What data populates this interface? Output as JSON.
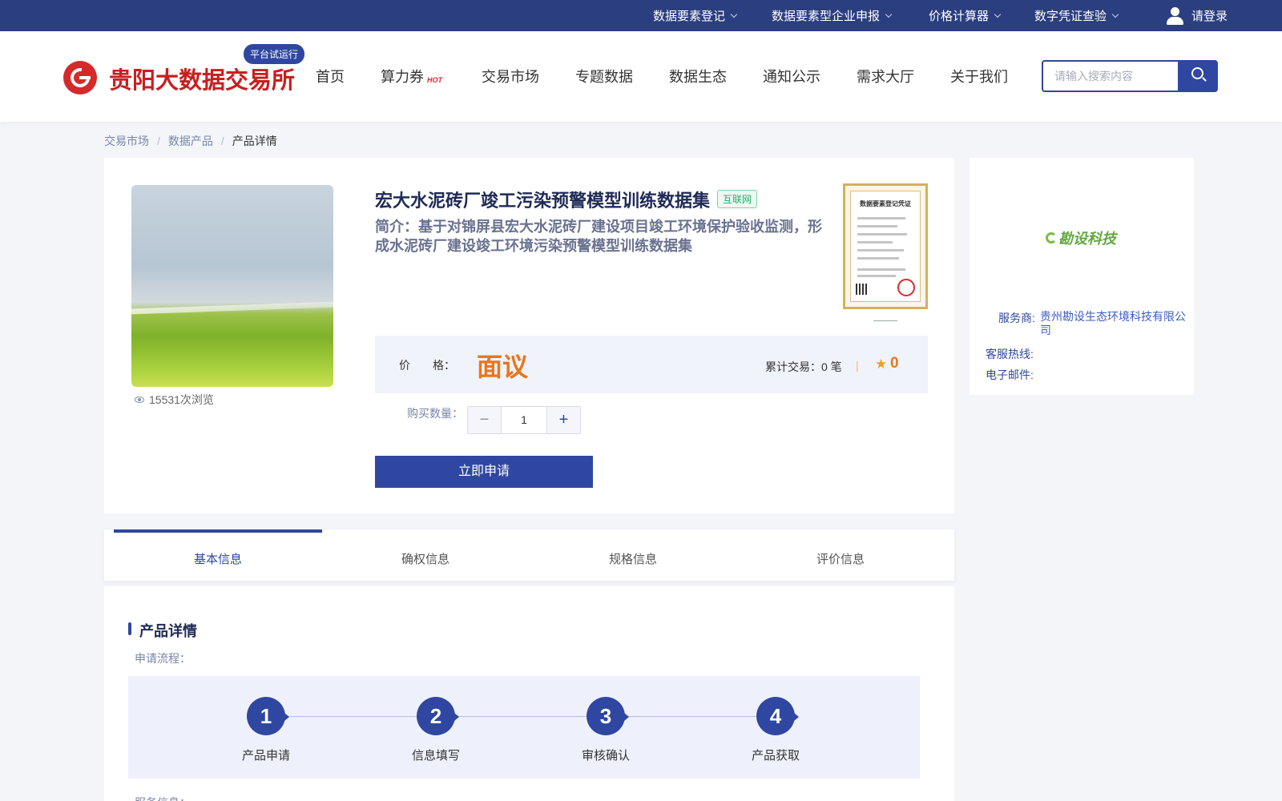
{
  "topbar": {
    "items": [
      {
        "label": "数据要素登记"
      },
      {
        "label": "数据要素型企业申报"
      },
      {
        "label": "价格计算器"
      },
      {
        "label": "数字凭证查验"
      }
    ],
    "login": "请登录"
  },
  "header": {
    "logo_text": "贵阳大数据交易所",
    "badge": "平台试运行",
    "nav": [
      {
        "label": "首页"
      },
      {
        "label": "算力券"
      },
      {
        "label": "交易市场"
      },
      {
        "label": "专题数据"
      },
      {
        "label": "数据生态"
      },
      {
        "label": "通知公示"
      },
      {
        "label": "需求大厅"
      },
      {
        "label": "关于我们"
      }
    ],
    "hot_label": "HOT",
    "search_placeholder": "请输入搜索内容"
  },
  "breadcrumb": {
    "items": [
      "交易市场",
      "数据产品",
      "产品详情"
    ],
    "separator": "/"
  },
  "product": {
    "title": "宏大水泥砖厂竣工污染预警模型训练数据集",
    "tag": "互联网",
    "description": "简介：基于对锦屏县宏大水泥砖厂建设项目竣工环境保护验收监测，形成水泥砖厂建设竣工环境污染预警模型训练数据集",
    "views": "15531次浏览",
    "cert_title": "数据要素登记凭证",
    "price_label": "价　　格：",
    "price": "面议",
    "trade_count": "累计交易：0 笔",
    "divider": "|",
    "rating": "0",
    "qty_label": "购买数量：",
    "qty_value": "1",
    "qty_minus": "−",
    "qty_plus": "+",
    "apply_label": "立即申请"
  },
  "vendor": {
    "logo_text": "勘设科技",
    "provider_label": "服务商:",
    "provider_name": "贵州勘设生态环境科技有限公司",
    "hotline_label": "客服热线:",
    "email_label": "电子邮件:"
  },
  "tabs": [
    {
      "label": "基本信息"
    },
    {
      "label": "确权信息"
    },
    {
      "label": "规格信息"
    },
    {
      "label": "评价信息"
    }
  ],
  "details": {
    "section_title": "产品详情",
    "flow_label": "申请流程：",
    "steps": [
      {
        "num": "1",
        "label": "产品申请"
      },
      {
        "num": "2",
        "label": "信息填写"
      },
      {
        "num": "3",
        "label": "审核确认"
      },
      {
        "num": "4",
        "label": "产品获取"
      }
    ],
    "service_label": "服务信息："
  },
  "colors": {
    "primary": "#2f47a0",
    "topbar": "#2b3e7f",
    "price": "#e8761e",
    "logo_red": "#c81e1e"
  }
}
